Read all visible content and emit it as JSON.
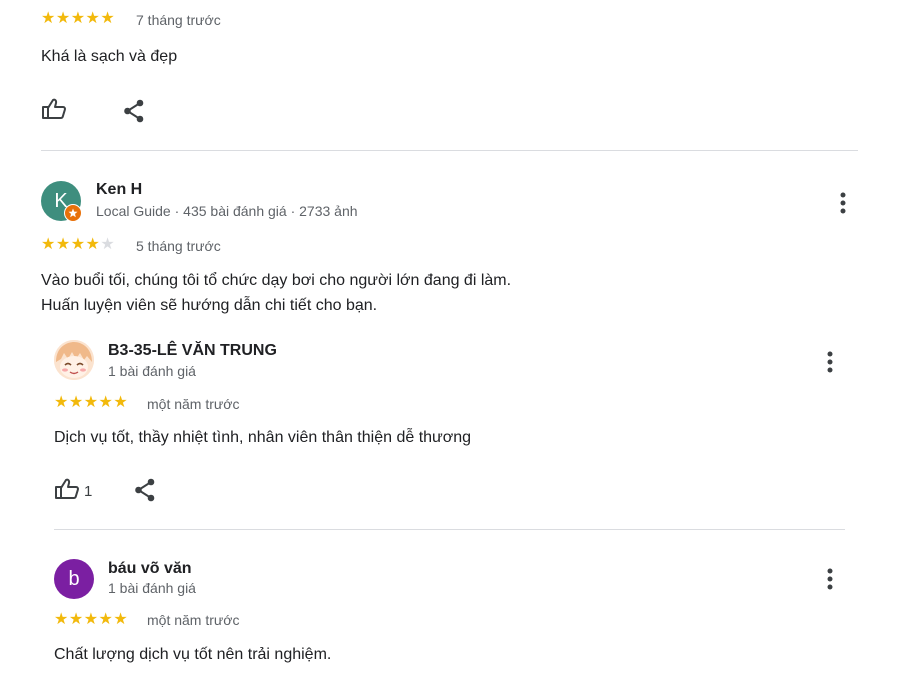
{
  "reviews": [
    {
      "time": "7 tháng trước",
      "text": "Khá là sạch và đẹp",
      "rating": 5
    },
    {
      "avatar_letter": "K",
      "author": "Ken H",
      "meta": "Local Guide · 435 bài đánh giá · 2733 ảnh",
      "rating": 4,
      "time": "5 tháng trước",
      "text_line1": "Vào buổi tối, chúng tôi tổ chức dạy bơi cho người lớn đang đi làm.",
      "text_line2": "Huấn luyện viên sẽ hướng dẫn chi tiết cho bạn."
    },
    {
      "author": "B3-35-LÊ VĂN TRUNG",
      "meta": "1 bài đánh giá",
      "rating": 5,
      "time": "một năm trước",
      "text": "Dịch vụ tốt, thầy nhiệt tình, nhân viên thân thiện dễ thương",
      "likes": "1"
    },
    {
      "avatar_letter": "b",
      "author": "báu võ văn",
      "meta": "1 bài đánh giá",
      "rating": 5,
      "time": "một năm trước",
      "text": "Chất lượng dịch vụ tốt nên trải nghiệm."
    }
  ],
  "colors": {
    "star": "#f2b90c",
    "star_empty": "#dadce0",
    "avatar_ken": "#3e8e7e",
    "avatar_bau": "#7b1fa2",
    "local_guide_badge": "#e8710a"
  },
  "icons": [
    "thumb-up-icon",
    "share-icon",
    "more-vert-icon",
    "local-guide-badge-icon"
  ]
}
